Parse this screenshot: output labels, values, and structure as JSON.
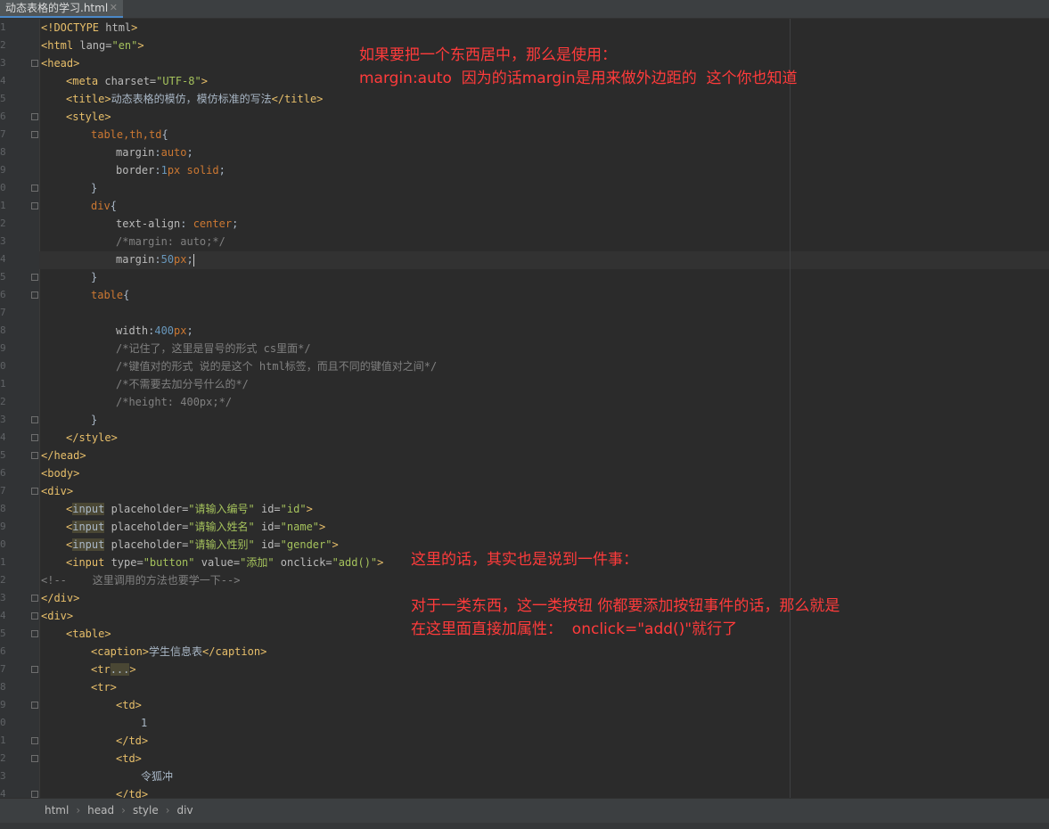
{
  "tab": {
    "title": "动态表格的学习.html",
    "close": "✕"
  },
  "line_numbers": [
    "1",
    "2",
    "3",
    "4",
    "5",
    "6",
    "7",
    "8",
    "9",
    "0",
    "1",
    "2",
    "3",
    "4",
    "5",
    "6",
    "7",
    "8",
    "9",
    "0",
    "1",
    "2",
    "3",
    "4",
    "5",
    "6",
    "7",
    "8",
    "9",
    "0",
    "1",
    "2",
    "3",
    "4",
    "5",
    "6",
    "7",
    "8",
    "9",
    "0",
    "1",
    "2",
    "3",
    "4"
  ],
  "code": [
    {
      "indent": 0,
      "parts": [
        [
          "tg",
          "<!DOCTYPE "
        ],
        [
          "at",
          "html"
        ],
        [
          "tg",
          ">"
        ]
      ]
    },
    {
      "indent": 0,
      "parts": [
        [
          "tg",
          "<html "
        ],
        [
          "at",
          "lang="
        ],
        [
          "st",
          "\"en\""
        ],
        [
          "tg",
          ">"
        ]
      ]
    },
    {
      "indent": 0,
      "parts": [
        [
          "tg",
          "<head>"
        ]
      ]
    },
    {
      "indent": 4,
      "parts": [
        [
          "tg",
          "<meta "
        ],
        [
          "at",
          "charset="
        ],
        [
          "st",
          "\"UTF-8\""
        ],
        [
          "tg",
          ">"
        ]
      ]
    },
    {
      "indent": 4,
      "parts": [
        [
          "tg",
          "<title>"
        ],
        [
          "tx",
          "动态表格的模仿，模仿标准的写法"
        ],
        [
          "tg",
          "</title>"
        ]
      ]
    },
    {
      "indent": 4,
      "parts": [
        [
          "tg",
          "<style>"
        ]
      ]
    },
    {
      "indent": 8,
      "parts": [
        [
          "kw",
          "table,th,td"
        ],
        [
          "tx",
          "{"
        ]
      ]
    },
    {
      "indent": 12,
      "parts": [
        [
          "pr",
          "margin"
        ],
        [
          "tx",
          ":"
        ],
        [
          "kw",
          "auto"
        ],
        [
          "tx",
          ";"
        ]
      ]
    },
    {
      "indent": 12,
      "parts": [
        [
          "pr",
          "border"
        ],
        [
          "tx",
          ":"
        ],
        [
          "nm",
          "1"
        ],
        [
          "kw",
          "px solid"
        ],
        [
          "tx",
          ";"
        ]
      ]
    },
    {
      "indent": 8,
      "parts": [
        [
          "tx",
          "}"
        ]
      ]
    },
    {
      "indent": 8,
      "parts": [
        [
          "kw",
          "div"
        ],
        [
          "tx",
          "{"
        ]
      ]
    },
    {
      "indent": 12,
      "parts": [
        [
          "pr",
          "text-align"
        ],
        [
          "tx",
          ": "
        ],
        [
          "kw",
          "center"
        ],
        [
          "tx",
          ";"
        ]
      ]
    },
    {
      "indent": 12,
      "parts": [
        [
          "cm",
          "/*margin: auto;*/"
        ]
      ]
    },
    {
      "indent": 12,
      "parts": [
        [
          "pr",
          "margin"
        ],
        [
          "tx",
          ":"
        ],
        [
          "nm",
          "50"
        ],
        [
          "kw",
          "px"
        ],
        [
          "tx",
          ";"
        ],
        [
          "cur",
          ""
        ]
      ]
    },
    {
      "indent": 8,
      "parts": [
        [
          "tx",
          "}"
        ]
      ]
    },
    {
      "indent": 8,
      "parts": [
        [
          "kw",
          "table"
        ],
        [
          "tx",
          "{"
        ]
      ]
    },
    {
      "indent": 0,
      "parts": []
    },
    {
      "indent": 12,
      "parts": [
        [
          "pr",
          "width"
        ],
        [
          "tx",
          ":"
        ],
        [
          "nm",
          "400"
        ],
        [
          "kw",
          "px"
        ],
        [
          "tx",
          ";"
        ]
      ]
    },
    {
      "indent": 12,
      "parts": [
        [
          "cm",
          "/*记住了，这里是冒号的形式 cs里面*/"
        ]
      ]
    },
    {
      "indent": 12,
      "parts": [
        [
          "cm",
          "/*键值对的形式 说的是这个 html标签，而且不同的键值对之间*/"
        ]
      ]
    },
    {
      "indent": 12,
      "parts": [
        [
          "cm",
          "/*不需要去加分号什么的*/"
        ]
      ]
    },
    {
      "indent": 12,
      "parts": [
        [
          "cm",
          "/*height: 400px;*/"
        ]
      ]
    },
    {
      "indent": 8,
      "parts": [
        [
          "tx",
          "}"
        ]
      ]
    },
    {
      "indent": 4,
      "parts": [
        [
          "tg",
          "</style>"
        ]
      ]
    },
    {
      "indent": 0,
      "parts": [
        [
          "tg",
          "</head>"
        ]
      ]
    },
    {
      "indent": 0,
      "parts": [
        [
          "tg",
          "<body>"
        ]
      ]
    },
    {
      "indent": 0,
      "parts": [
        [
          "tg",
          "<div>"
        ]
      ]
    },
    {
      "indent": 4,
      "parts": [
        [
          "tg",
          "<"
        ],
        [
          "hl",
          "input"
        ],
        [
          "tg",
          " "
        ],
        [
          "at",
          "placeholder="
        ],
        [
          "st",
          "\"请输入编号\""
        ],
        [
          "tg",
          " "
        ],
        [
          "at",
          "id="
        ],
        [
          "st",
          "\"id\""
        ],
        [
          "tg",
          ">"
        ]
      ]
    },
    {
      "indent": 4,
      "parts": [
        [
          "tg",
          "<"
        ],
        [
          "hl",
          "input"
        ],
        [
          "tg",
          " "
        ],
        [
          "at",
          "placeholder="
        ],
        [
          "st",
          "\"请输入姓名\""
        ],
        [
          "tg",
          " "
        ],
        [
          "at",
          "id="
        ],
        [
          "st",
          "\"name\""
        ],
        [
          "tg",
          ">"
        ]
      ]
    },
    {
      "indent": 4,
      "parts": [
        [
          "tg",
          "<"
        ],
        [
          "hl",
          "input"
        ],
        [
          "tg",
          " "
        ],
        [
          "at",
          "placeholder="
        ],
        [
          "st",
          "\"请输入性别\""
        ],
        [
          "tg",
          " "
        ],
        [
          "at",
          "id="
        ],
        [
          "st",
          "\"gender\""
        ],
        [
          "tg",
          ">"
        ]
      ]
    },
    {
      "indent": 4,
      "parts": [
        [
          "tg",
          "<input "
        ],
        [
          "at",
          "type="
        ],
        [
          "st",
          "\"button\""
        ],
        [
          "tg",
          " "
        ],
        [
          "at",
          "value="
        ],
        [
          "st",
          "\"添加\""
        ],
        [
          "tg",
          " "
        ],
        [
          "at",
          "onclick="
        ],
        [
          "st",
          "\"add()\""
        ],
        [
          "tg",
          ">"
        ]
      ]
    },
    {
      "indent": 0,
      "parts": [
        [
          "cm",
          "<!--    这里调用的方法也要学一下-->"
        ]
      ]
    },
    {
      "indent": 0,
      "parts": [
        [
          "tg",
          "</div>"
        ]
      ]
    },
    {
      "indent": 0,
      "parts": [
        [
          "tg",
          "<div>"
        ]
      ]
    },
    {
      "indent": 4,
      "parts": [
        [
          "tg",
          "<table>"
        ]
      ]
    },
    {
      "indent": 8,
      "parts": [
        [
          "tg",
          "<caption>"
        ],
        [
          "tx",
          "学生信息表"
        ],
        [
          "tg",
          "</caption>"
        ]
      ]
    },
    {
      "indent": 8,
      "parts": [
        [
          "tg",
          "<tr"
        ],
        [
          "hl",
          "..."
        ],
        [
          "tg",
          ">"
        ]
      ]
    },
    {
      "indent": 8,
      "parts": [
        [
          "tg",
          "<tr>"
        ]
      ]
    },
    {
      "indent": 12,
      "parts": [
        [
          "tg",
          "<td>"
        ]
      ]
    },
    {
      "indent": 16,
      "parts": [
        [
          "tx",
          "1"
        ]
      ]
    },
    {
      "indent": 12,
      "parts": [
        [
          "tg",
          "</td>"
        ]
      ]
    },
    {
      "indent": 12,
      "parts": [
        [
          "tg",
          "<td>"
        ]
      ]
    },
    {
      "indent": 16,
      "parts": [
        [
          "tx",
          "令狐冲"
        ]
      ]
    },
    {
      "indent": 12,
      "parts": [
        [
          "tg",
          "</td>"
        ]
      ]
    }
  ],
  "annotations": {
    "top_line1": "如果要把一个东西居中，那么是使用：",
    "top_line2": "margin:auto  因为的话margin是用来做外边距的  这个你也知道",
    "mid_line1": "这里的话，其实也是说到一件事：",
    "mid_line2": "对于一类东西，这一类按钮 你都要添加按钮事件的话，那么就是",
    "mid_line3": "在这里面直接加属性：  onclick=\"add()\"就行了"
  },
  "breadcrumb": [
    "html",
    "head",
    "style",
    "div"
  ]
}
